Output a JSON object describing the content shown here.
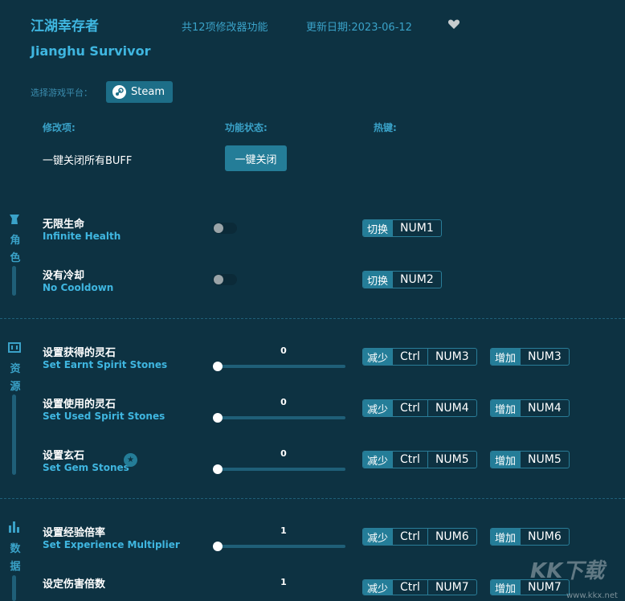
{
  "header": {
    "title_cn": "江湖幸存者",
    "title_en": "Jianghu Survivor",
    "feature_count": "共12项修改器功能",
    "update_date": "更新日期:2023-06-12",
    "favorite_icon": "heart-icon"
  },
  "platform": {
    "label": "选择游戏平台：",
    "selected": "Steam",
    "icon": "steam-icon"
  },
  "columns": {
    "item": "修改项:",
    "status": "功能状态:",
    "hotkey": "热键:"
  },
  "all_off": {
    "label": "一键关闭所有BUFF",
    "button": "一键关闭"
  },
  "sections": [
    {
      "label": "角色",
      "icon": "character-icon"
    },
    {
      "label": "资源",
      "icon": "resource-icon"
    },
    {
      "label": "数据",
      "icon": "data-icon"
    }
  ],
  "toggles": [
    {
      "cn": "无限生命",
      "en": "Infinite Health",
      "enabled": false,
      "tag": "切换",
      "key": "NUM1"
    },
    {
      "cn": "没有冷却",
      "en": "No Cooldown",
      "enabled": false,
      "tag": "切换",
      "key": "NUM2"
    }
  ],
  "sliders": [
    {
      "cn": "设置获得的灵石",
      "en": "Set Earnt Spirit Stones",
      "value": "0",
      "dec_tag": "减少",
      "dec_mod": "Ctrl",
      "dec_key": "NUM3",
      "inc_tag": "增加",
      "inc_key": "NUM3"
    },
    {
      "cn": "设置使用的灵石",
      "en": "Set Used Spirit Stones",
      "value": "0",
      "dec_tag": "减少",
      "dec_mod": "Ctrl",
      "dec_key": "NUM4",
      "inc_tag": "增加",
      "inc_key": "NUM4"
    },
    {
      "cn": "设置玄石",
      "en": "Set Gem Stones",
      "value": "0",
      "dec_tag": "减少",
      "dec_mod": "Ctrl",
      "dec_key": "NUM5",
      "inc_tag": "增加",
      "inc_key": "NUM5",
      "starred": true
    },
    {
      "cn": "设置经验倍率",
      "en": "Set Experience Multiplier",
      "value": "1",
      "dec_tag": "减少",
      "dec_mod": "Ctrl",
      "dec_key": "NUM6",
      "inc_tag": "增加",
      "inc_key": "NUM6"
    },
    {
      "cn": "设定伤害倍数",
      "en": "",
      "value": "1",
      "dec_tag": "减少",
      "dec_mod": "Ctrl",
      "dec_key": "NUM7",
      "inc_tag": "增加",
      "inc_key": "NUM7"
    }
  ],
  "watermark": {
    "text": "KK下载",
    "url": "www.kkx.net"
  },
  "colors": {
    "background": "#0d3242",
    "accent": "#3fb6e0",
    "tag": "#247d98"
  }
}
